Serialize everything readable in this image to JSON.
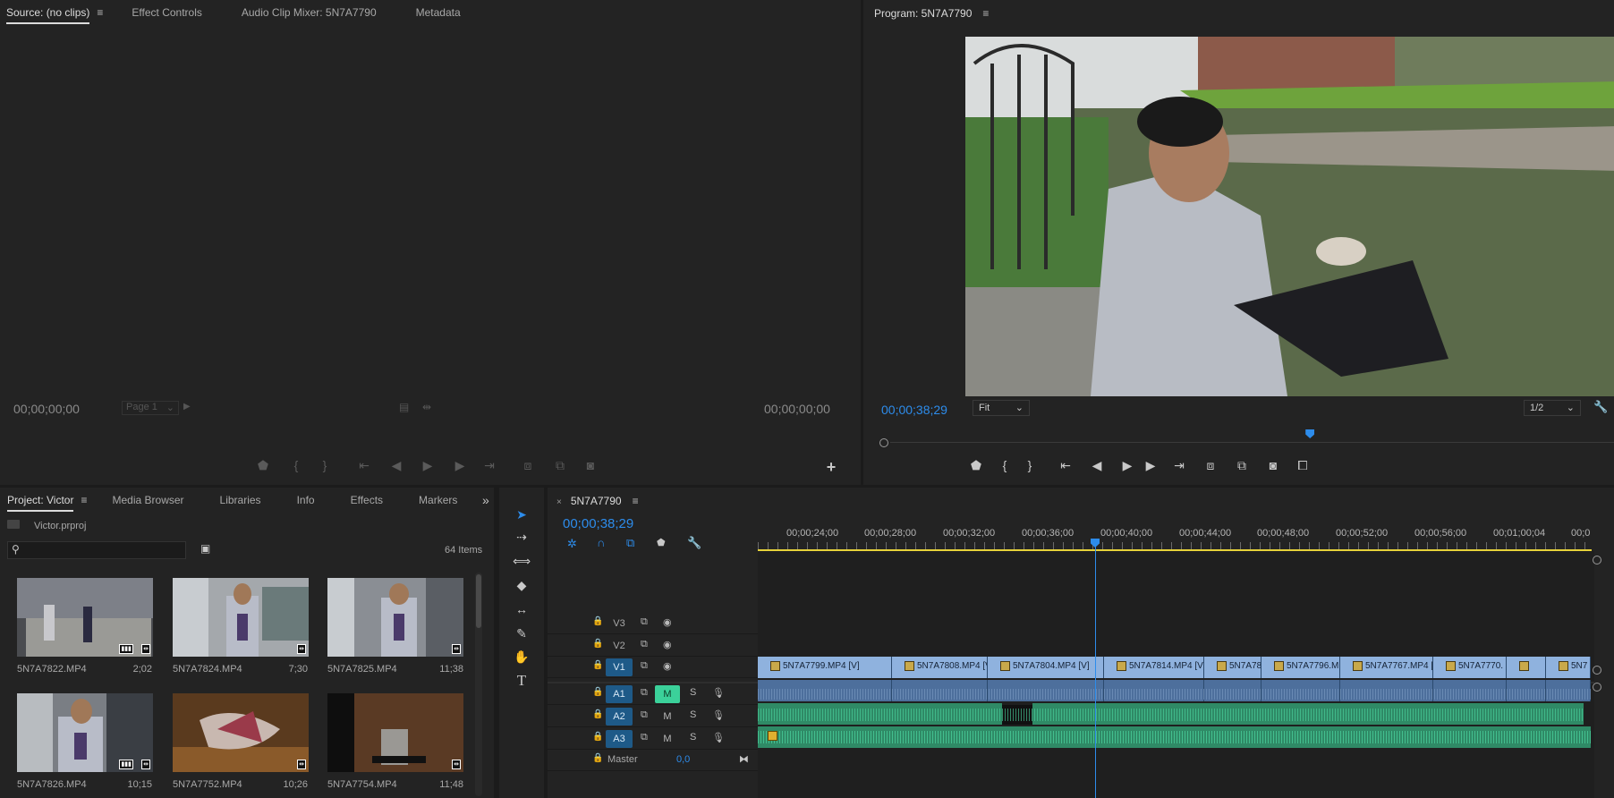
{
  "source_panel": {
    "tabs": [
      {
        "label": "Source: (no clips)",
        "active": true
      },
      {
        "label": "Effect Controls",
        "active": false
      },
      {
        "label": "Audio Clip Mixer: 5N7A7790",
        "active": false
      },
      {
        "label": "Metadata",
        "active": false
      }
    ],
    "timecode_left": "00;00;00;00",
    "timecode_right": "00;00;00;00",
    "page_select": "Page 1"
  },
  "program_panel": {
    "title": "Program: 5N7A7790",
    "timecode": "00;00;38;29",
    "fit_select": "Fit",
    "resolution_select": "1/2",
    "playhead_fraction": 0.58
  },
  "project_panel": {
    "tabs": [
      {
        "label": "Project: Victor",
        "active": true
      },
      {
        "label": "Media Browser",
        "active": false
      },
      {
        "label": "Libraries",
        "active": false
      },
      {
        "label": "Info",
        "active": false
      },
      {
        "label": "Effects",
        "active": false
      },
      {
        "label": "Markers",
        "active": false
      }
    ],
    "file_name": "Victor.prproj",
    "item_count": "64 Items",
    "search_placeholder": "",
    "items": [
      {
        "name": "5N7A7822.MP4",
        "duration": "2;02"
      },
      {
        "name": "5N7A7824.MP4",
        "duration": "7;30"
      },
      {
        "name": "5N7A7825.MP4",
        "duration": "11;38"
      },
      {
        "name": "5N7A7826.MP4",
        "duration": "10;15"
      },
      {
        "name": "5N7A7752.MP4",
        "duration": "10;26"
      },
      {
        "name": "5N7A7754.MP4",
        "duration": "11;48"
      }
    ]
  },
  "timeline": {
    "sequence_tab": "5N7A7790",
    "timecode": "00;00;38;29",
    "ruler_labels": [
      "00;00;24;00",
      "00;00;28;00",
      "00;00;32;00",
      "00;00;36;00",
      "00;00;40;00",
      "00;00;44;00",
      "00;00;48;00",
      "00;00;52;00",
      "00;00;56;00",
      "00;01;00;04",
      "00;0"
    ],
    "tracks": {
      "v3": "V3",
      "v2": "V2",
      "v1": "V1",
      "a1": "A1",
      "a2": "A2",
      "a3": "A3",
      "master": "Master",
      "master_value": "0,0",
      "m": "M",
      "s": "S"
    },
    "v1_clips": [
      "5N7A7799.MP4 [V]",
      "5N7A7808.MP4 [V",
      "5N7A7804.MP4 [V]",
      "5N7A7814.MP4 [V]",
      "5N7A78",
      "5N7A7796.M",
      "5N7A7767.MP4 [",
      "5N7A7770.",
      "",
      "5N7"
    ]
  },
  "colors": {
    "accent_blue": "#2d8ceb",
    "video_clip": "#8fb2de",
    "audio_green": "#3bd19a",
    "playhead": "#2d8ceb"
  }
}
